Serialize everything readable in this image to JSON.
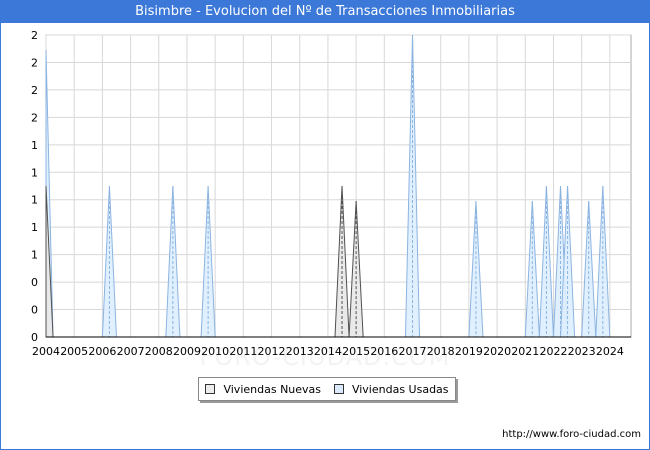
{
  "title": "Bisimbre - Evolucion del Nº de Transacciones Inmobiliarias",
  "source": "http://www.foro-ciudad.com",
  "watermark": "FORO-CIUDAD.COM",
  "colors": {
    "header": "#3b78d8",
    "nuevas_fill": "#e8e8e8",
    "nuevas_stroke": "#505050",
    "usadas_fill": "#ddeeff",
    "usadas_stroke": "#8cb4e0",
    "grid": "#d8d8d8"
  },
  "chart_data": {
    "type": "area",
    "title": "Bisimbre - Evolucion del Nº de Transacciones Inmobiliarias",
    "xlabel": "",
    "ylabel": "",
    "xlim": [
      2004,
      2024.75
    ],
    "ylim": [
      0,
      2
    ],
    "grid": true,
    "legend_position": "bottom-center",
    "y_tick_labels": [
      "0",
      "0",
      "0",
      "1",
      "1",
      "1",
      "1",
      "1",
      "2",
      "2",
      "2",
      "2"
    ],
    "x_tick_labels": [
      "2004",
      "2005",
      "2006",
      "2007",
      "2008",
      "2009",
      "2010",
      "2011",
      "2012",
      "2013",
      "2014",
      "2015",
      "2016",
      "2017",
      "2018",
      "2019",
      "2020",
      "2021",
      "2022",
      "2023",
      "2024"
    ],
    "series": [
      {
        "name": "Viviendas Nuevas",
        "points": [
          {
            "x": 2004.0,
            "y": 1.0
          },
          {
            "x": 2014.5,
            "y": 1.0
          },
          {
            "x": 2015.0,
            "y": 0.9
          }
        ]
      },
      {
        "name": "Viviendas Usadas",
        "points": [
          {
            "x": 2004.0,
            "y": 1.9
          },
          {
            "x": 2006.25,
            "y": 1.0
          },
          {
            "x": 2008.5,
            "y": 1.0
          },
          {
            "x": 2009.75,
            "y": 1.0
          },
          {
            "x": 2017.0,
            "y": 2.0
          },
          {
            "x": 2019.25,
            "y": 0.9
          },
          {
            "x": 2021.25,
            "y": 0.9
          },
          {
            "x": 2021.75,
            "y": 1.0
          },
          {
            "x": 2022.25,
            "y": 1.0
          },
          {
            "x": 2022.5,
            "y": 1.0
          },
          {
            "x": 2023.25,
            "y": 0.9
          },
          {
            "x": 2023.75,
            "y": 1.0
          }
        ]
      }
    ]
  }
}
